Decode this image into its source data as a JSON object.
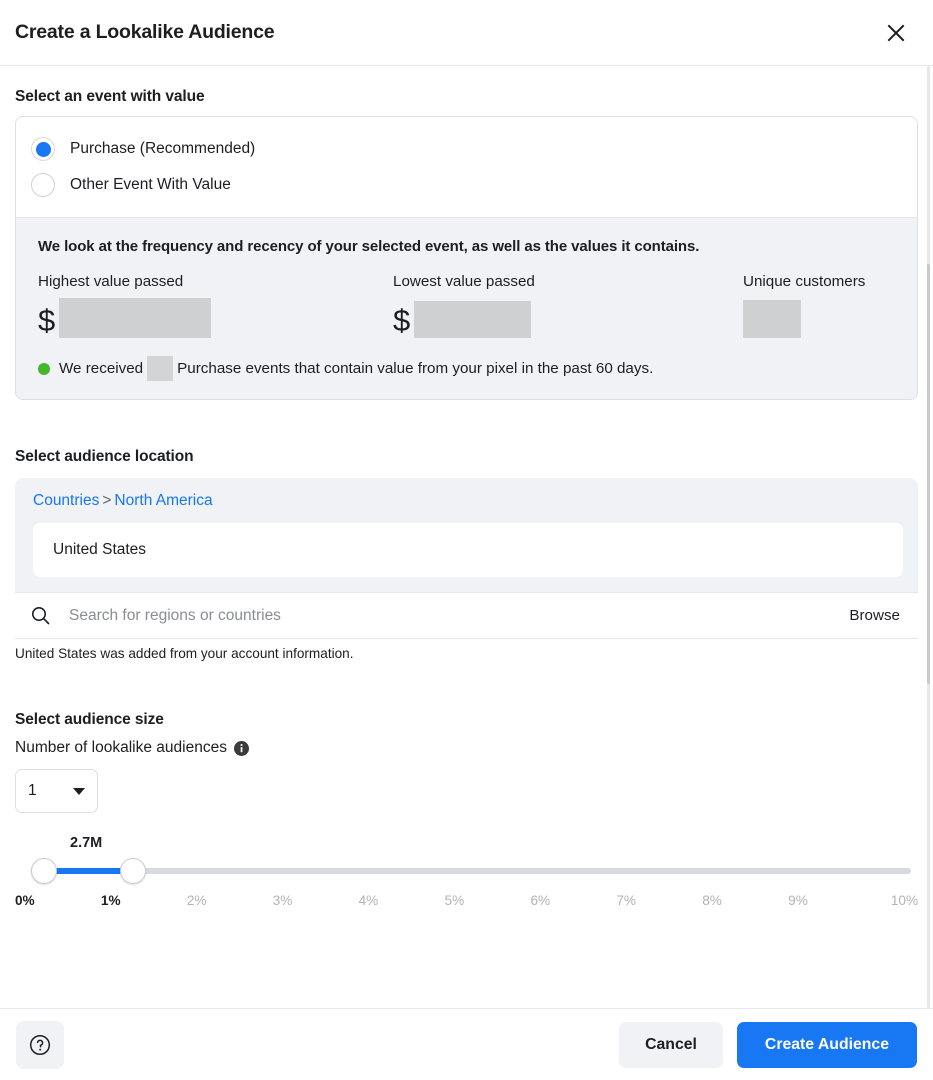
{
  "header": {
    "title": "Create a Lookalike Audience",
    "close_icon": "close-icon"
  },
  "event_section": {
    "title": "Select an event with value",
    "options": [
      {
        "label": "Purchase (Recommended)",
        "selected": true
      },
      {
        "label": "Other Event With Value",
        "selected": false
      }
    ],
    "info": {
      "heading": "We look at the frequency and recency of your selected event, as well as the values it contains.",
      "stats": [
        {
          "label": "Highest value passed",
          "prefix": "$",
          "value": ""
        },
        {
          "label": "Lowest value passed",
          "prefix": "$",
          "value": ""
        },
        {
          "label": "Unique customers",
          "prefix": "",
          "value": ""
        }
      ],
      "status": {
        "dot_color": "#42b72a",
        "text_before": "We received",
        "text_after": "Purchase events that contain value from your pixel in the past 60 days."
      }
    }
  },
  "location_section": {
    "title": "Select audience location",
    "breadcrumb": {
      "root": "Countries",
      "separator": ">",
      "current": "North America"
    },
    "selected_location": "United States",
    "search": {
      "placeholder": "Search for regions or countries",
      "icon": "search-icon",
      "browse_label": "Browse"
    },
    "note": "United States was added from your account information."
  },
  "size_section": {
    "title": "Select audience size",
    "count_label": "Number of lookalike audiences",
    "info_icon": "info-icon",
    "count_value": "1",
    "slider": {
      "bubble_label": "2.7M",
      "range_start": "0%",
      "range_end": "1%",
      "ticks": [
        "0%",
        "1%",
        "2%",
        "3%",
        "4%",
        "5%",
        "6%",
        "7%",
        "8%",
        "9%",
        "10%"
      ],
      "active_ticks": [
        "0%",
        "1%"
      ],
      "accent_color": "#1877f2"
    }
  },
  "footer": {
    "help_icon": "help-icon",
    "cancel_label": "Cancel",
    "create_label": "Create Audience"
  }
}
